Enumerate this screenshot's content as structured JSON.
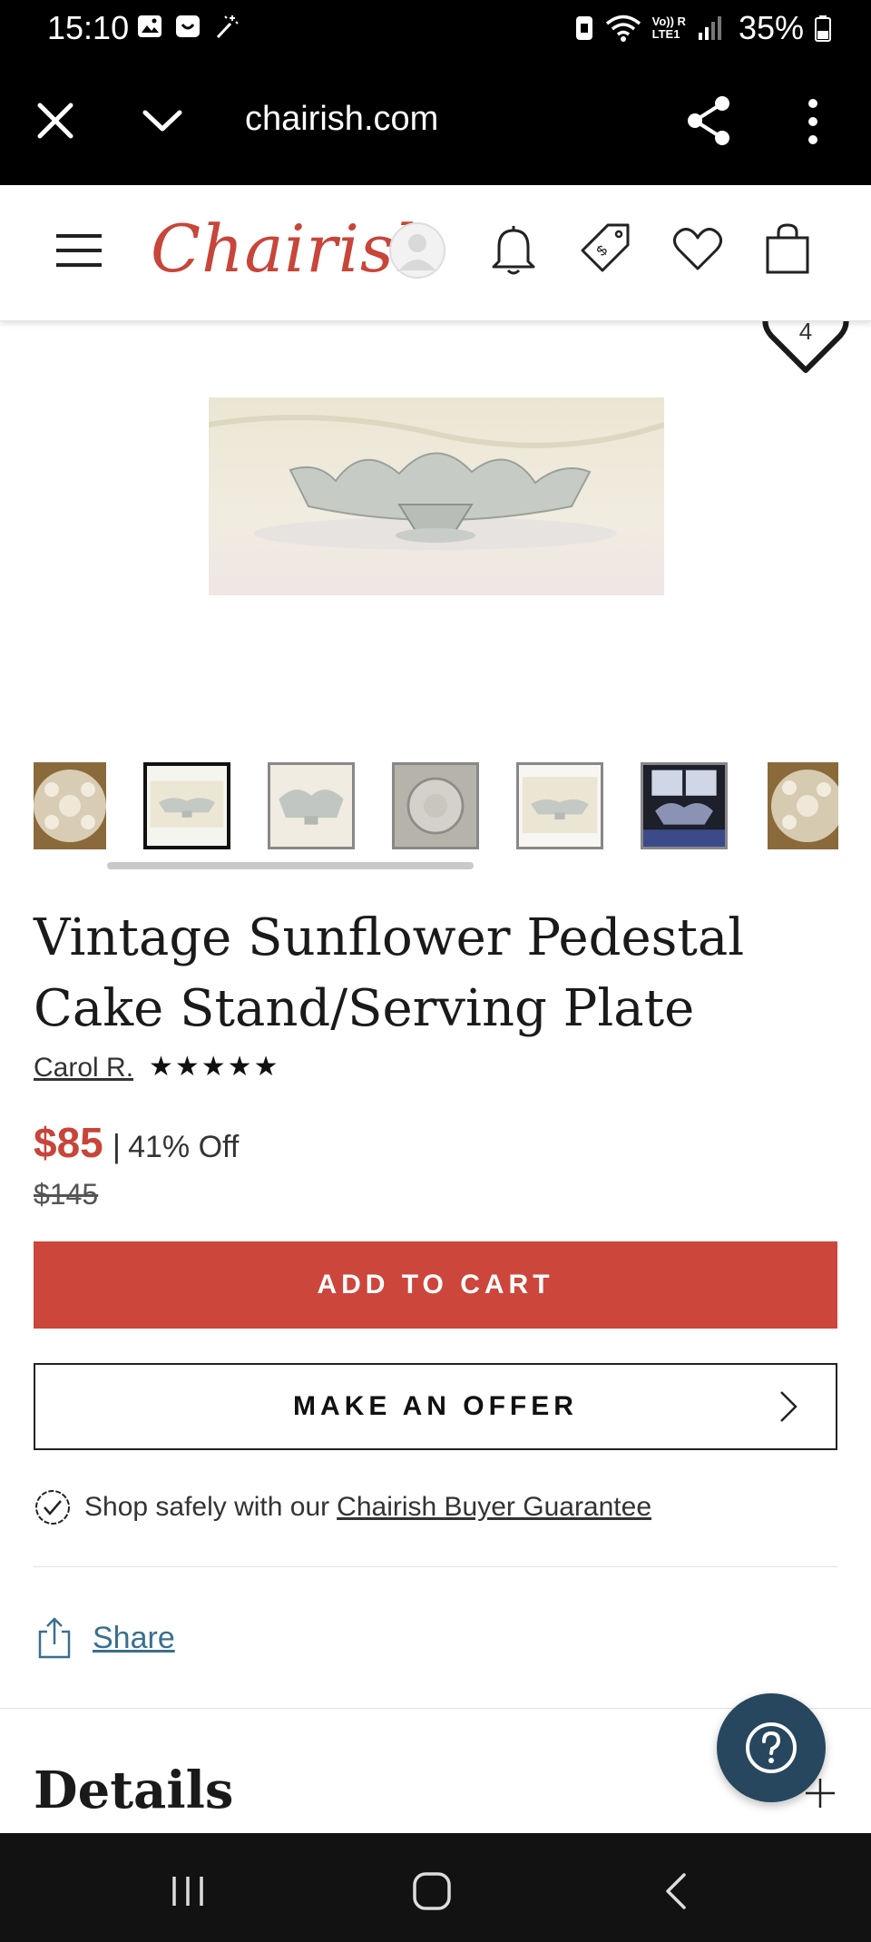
{
  "status_bar": {
    "time": "15:10",
    "battery": "35%",
    "icons": [
      "gallery-icon",
      "smile-icon",
      "magic-wand-icon",
      "sim-icon",
      "wifi-icon",
      "volte-icon",
      "signal-icon",
      "battery-icon"
    ],
    "volte_label": "Vo)) R",
    "lte_label": "LTE1"
  },
  "browser": {
    "url": "chairish.com",
    "icons": [
      "close-icon",
      "chevron-down-icon",
      "share-icon",
      "more-vert-icon"
    ]
  },
  "header": {
    "logo": "Chairish",
    "icons": [
      "menu-icon",
      "avatar-icon",
      "bell-icon",
      "price-tag-icon",
      "heart-icon",
      "shopping-bag-icon"
    ],
    "accent_color": "#c8453a"
  },
  "gallery": {
    "favorite_count": "4",
    "thumbnail_count": 7,
    "active_thumbnail": 2
  },
  "product": {
    "title": "Vintage Sunflower Pedestal Cake Stand/Serving Plate",
    "seller": "Carol R.",
    "rating_stars": "★★★★★",
    "rating_value": 5,
    "price": "$85",
    "separator": "|",
    "discount": "41% Off",
    "original_price": "$145",
    "price_color": "#c8453a"
  },
  "actions": {
    "add_to_cart": "ADD TO CART",
    "make_offer": "MAKE AN OFFER",
    "cart_button_color": "#cc463b"
  },
  "guarantee": {
    "prefix": "Shop safely with our",
    "link": "Chairish Buyer Guarantee"
  },
  "share": {
    "label": "Share"
  },
  "details": {
    "title": "Details"
  },
  "help": {
    "icon": "help-icon",
    "color": "#27475e"
  },
  "nav": {
    "icons": [
      "recent-apps-icon",
      "home-icon",
      "back-icon"
    ]
  }
}
